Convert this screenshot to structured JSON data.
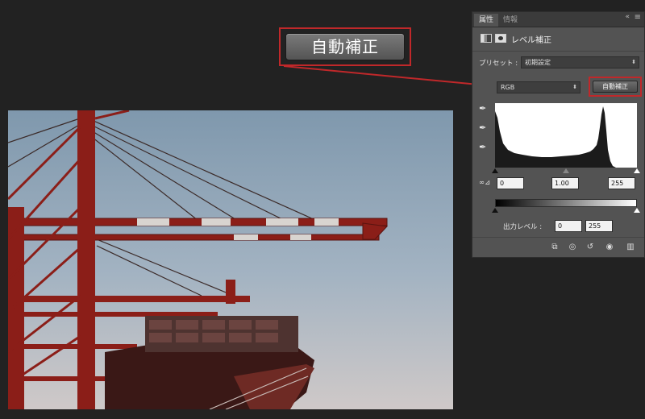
{
  "callout": {
    "label": "自動補正"
  },
  "panel": {
    "tabs": [
      "属性",
      "情報"
    ],
    "collapse": "«",
    "menu": "≡",
    "title": "レベル補正",
    "preset": {
      "label": "プリセット :",
      "value": "初期設定"
    },
    "channel": {
      "value": "RGB"
    },
    "auto_button": "自動補正",
    "input": {
      "label": "∞⊿",
      "black": "0",
      "gamma": "1.00",
      "white": "255"
    },
    "output": {
      "label": "出力レベル :",
      "black": "0",
      "white": "255"
    },
    "footer_icons": [
      "clip-to-layer-icon",
      "view-previous-icon",
      "reset-icon",
      "visibility-icon",
      "delete-icon"
    ]
  },
  "colors": {
    "accent_red": "#c0282a",
    "panel_bg": "#535353",
    "workspace_bg": "#222222",
    "crane_red": "#8b1e18"
  }
}
